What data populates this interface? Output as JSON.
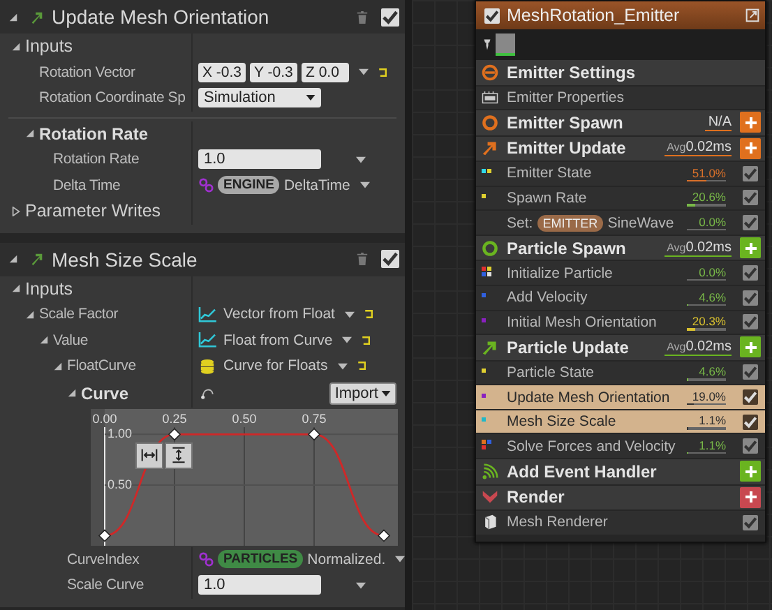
{
  "left_panel": {
    "sections": [
      {
        "title": "Update Mesh Orientation",
        "enabled": true,
        "rows": [
          {
            "kind": "group",
            "label": "Inputs",
            "expanded": true,
            "children": [
              {
                "kind": "vector",
                "label": "Rotation Vector",
                "components": [
                  "X -0.3",
                  "Y -0.3",
                  "Z 0.0"
                ]
              },
              {
                "kind": "dropdown",
                "label": "Rotation Coordinate Sp",
                "value": "Simulation"
              }
            ]
          },
          {
            "kind": "category",
            "label": "Rotation Rate",
            "expanded": true,
            "children": [
              {
                "kind": "number",
                "label": "Rotation Rate",
                "value": "1.0"
              },
              {
                "kind": "binding",
                "label": "Delta Time",
                "namespace": "ENGINE",
                "color": "#a8a8a8",
                "value": "DeltaTime"
              }
            ]
          },
          {
            "kind": "group",
            "label": "Parameter Writes",
            "expanded": false
          }
        ]
      },
      {
        "title": "Mesh Size Scale",
        "enabled": true,
        "rows": [
          {
            "kind": "group",
            "label": "Inputs",
            "expanded": true,
            "children": [
              {
                "kind": "function",
                "label": "Scale Factor",
                "value": "Vector from Float",
                "expanded": true,
                "children": [
                  {
                    "kind": "function",
                    "label": "Value",
                    "value": "Float from Curve",
                    "expanded": true,
                    "children": [
                      {
                        "kind": "asset",
                        "label": "FloatCurve",
                        "value": "Curve for Floats",
                        "expanded": true,
                        "children": [
                          {
                            "kind": "curve",
                            "label": "Curve",
                            "expanded": true,
                            "button": "Import",
                            "chart_data": {
                              "type": "line",
                              "x": [
                                0,
                                0.25,
                                0.75,
                                1
                              ],
                              "series": [
                                {
                                  "color": "#d02828",
                                  "values": [
                                    0,
                                    1,
                                    1,
                                    0
                                  ]
                                }
                              ],
                              "grid": true,
                              "marker": "diamond",
                              "xlim": [
                                -0.05,
                                1.05
                              ],
                              "ylim": [
                                -0.1,
                                1.25
                              ],
                              "xticks": [
                                {
                                  "value": 0,
                                  "label": "0.00"
                                },
                                {
                                  "value": 0.25,
                                  "label": "0.25"
                                },
                                {
                                  "value": 0.5,
                                  "label": "0.50"
                                },
                                {
                                  "value": 0.75,
                                  "label": "0.75"
                                }
                              ],
                              "yticks": [
                                {
                                  "value": 0.5,
                                  "label": "0.50"
                                },
                                {
                                  "value": 1,
                                  "label": "1.00"
                                }
                              ]
                            }
                          }
                        ]
                      },
                      {
                        "kind": "binding",
                        "label": "CurveIndex",
                        "namespace": "PARTICLES",
                        "color": "#3f8a45",
                        "value": "Normalized."
                      },
                      {
                        "kind": "number",
                        "label": "Scale Curve",
                        "value": "1.0"
                      }
                    ]
                  }
                ]
              }
            ]
          }
        ]
      }
    ]
  },
  "emitter_node": {
    "title": "MeshRotation_Emitter",
    "enabled": true,
    "items": [
      {
        "kind": "settings",
        "label": "Emitter Settings",
        "color": "#e0701e"
      },
      {
        "kind": "properties",
        "label": "Emitter Properties"
      },
      {
        "kind": "spawn_stage",
        "label": "Emitter Spawn",
        "color": "#e0701e",
        "timing": "N/A"
      },
      {
        "kind": "update_stage",
        "label": "Emitter Update",
        "color": "#e0701e",
        "timing_prefix": "Avg",
        "timing": "0.02ms"
      },
      {
        "kind": "module",
        "label": "Emitter State",
        "dots": [
          {
            "color": "#30d8e8"
          },
          {
            "color": "#e0d030"
          }
        ],
        "reading": "51.0%",
        "color": "#d8702a",
        "level": 0.51,
        "checked": true,
        "selected": false
      },
      {
        "kind": "module",
        "label": "Spawn Rate",
        "dots": [
          {
            "color": "#e0d030"
          }
        ],
        "reading": "20.6%",
        "color": "#78b848",
        "level": 0.206,
        "checked": true,
        "selected": false
      },
      {
        "kind": "set",
        "prefix": "Set:",
        "namespace": "EMITTER",
        "label": "SineWave",
        "reading": "0.0%",
        "color": "#78b848",
        "level": 0,
        "checked": true,
        "selected": false
      },
      {
        "kind": "spawn_stage",
        "label": "Particle Spawn",
        "color": "#6ab420",
        "timing_prefix": "Avg",
        "timing": "0.02ms"
      },
      {
        "kind": "module",
        "label": "Initialize Particle",
        "dots": [
          {
            "color": "#e03030"
          },
          {
            "color": "#e0d030"
          },
          {
            "color": "#3060e0"
          },
          {
            "color": "#e0e0e0"
          }
        ],
        "reading": "0.0%",
        "color": "#78b848",
        "level": 0,
        "checked": true,
        "selected": false
      },
      {
        "kind": "module",
        "label": "Add Velocity",
        "dots": [
          {
            "color": "#3060e0"
          }
        ],
        "reading": "4.6%",
        "color": "#78b848",
        "level": 0.046,
        "checked": true,
        "selected": false
      },
      {
        "kind": "module",
        "label": "Initial Mesh Orientation",
        "dots": [
          {
            "color": "#8a20c0"
          }
        ],
        "reading": "20.3%",
        "color": "#d8c030",
        "level": 0.203,
        "checked": true,
        "selected": false
      },
      {
        "kind": "update_stage",
        "label": "Particle Update",
        "color": "#6ab420",
        "timing_prefix": "Avg",
        "timing": "0.02ms"
      },
      {
        "kind": "module",
        "label": "Particle State",
        "dots": [
          {
            "color": "#e0d030"
          }
        ],
        "reading": "4.6%",
        "color": "#78b848",
        "level": 0.046,
        "checked": true,
        "selected": false
      },
      {
        "kind": "module",
        "label": "Update Mesh Orientation",
        "dots": [
          {
            "color": "#8a20c0"
          }
        ],
        "reading": "19.0%",
        "color": "#303030",
        "level": 0.19,
        "checked": true,
        "selected": true
      },
      {
        "kind": "module",
        "label": "Mesh Size Scale",
        "dots": [
          {
            "color": "#20b8c8"
          }
        ],
        "reading": "1.1%",
        "color": "#303030",
        "level": 0.011,
        "checked": true,
        "selected": true
      },
      {
        "kind": "module",
        "label": "Solve Forces and Velocity",
        "dots": [
          {
            "color": "#e07020"
          },
          {
            "color": "#3060e0"
          },
          {
            "color": "#e03030"
          }
        ],
        "reading": "1.1%",
        "color": "#78b848",
        "level": 0.011,
        "checked": true,
        "selected": false
      },
      {
        "kind": "event",
        "label": "Add Event Handler",
        "color": "#6ab420"
      },
      {
        "kind": "render",
        "label": "Render",
        "color": "#c84850"
      },
      {
        "kind": "renderer",
        "label": "Mesh Renderer",
        "checked": true
      }
    ]
  }
}
